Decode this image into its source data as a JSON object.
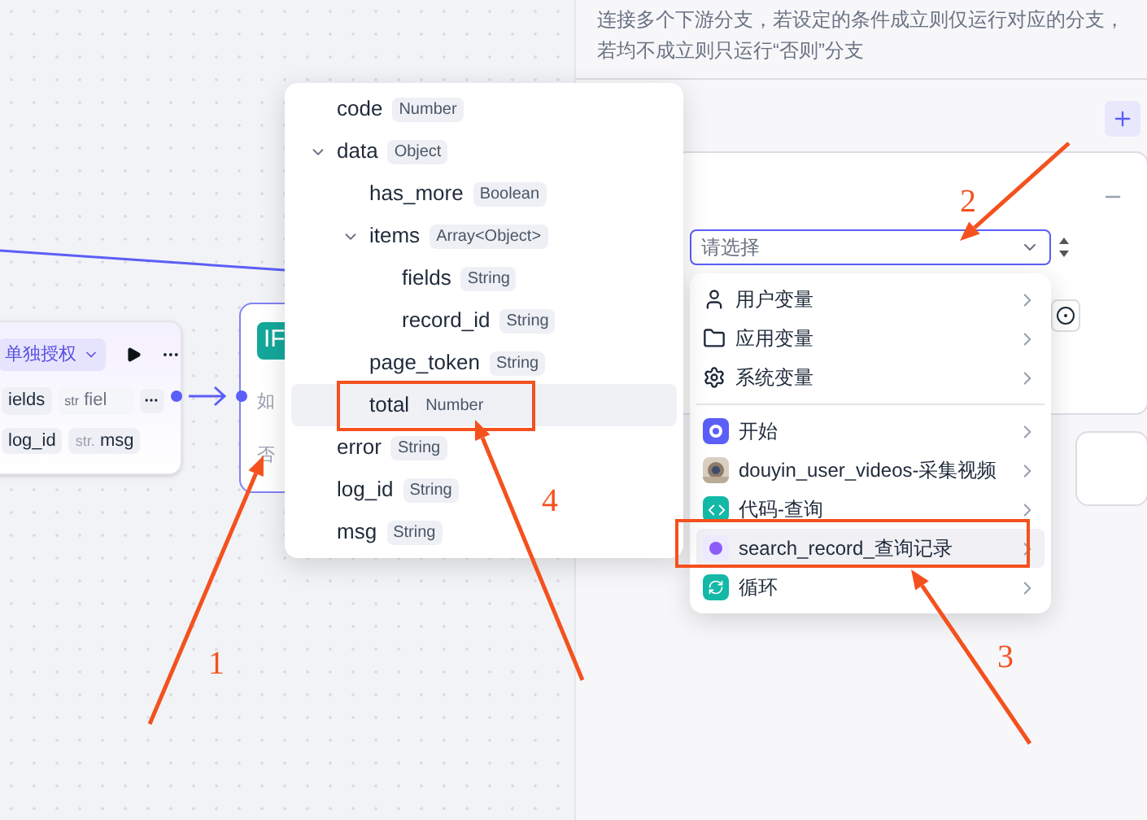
{
  "canvas": {
    "plugin_node": {
      "auth_tag": "单独授权",
      "input_name": "ields",
      "input_type": "str",
      "input_value": "fiel",
      "outputs": [
        {
          "name": "log_id"
        },
        {
          "type": "str.",
          "name": "msg"
        }
      ]
    },
    "if_node": {
      "badge": "IF",
      "branches": [
        "如",
        "否"
      ]
    }
  },
  "variable_tree": [
    {
      "name": "code",
      "type": "Number",
      "selected": false
    },
    {
      "name": "data",
      "type": "Object",
      "expanded": true,
      "selected": false,
      "children": [
        {
          "name": "has_more",
          "type": "Boolean",
          "selected": false
        },
        {
          "name": "items",
          "type": "Array<Object>",
          "expanded": true,
          "selected": false,
          "children": [
            {
              "name": "fields",
              "type": "String",
              "selected": false
            },
            {
              "name": "record_id",
              "type": "String",
              "selected": false
            }
          ]
        },
        {
          "name": "page_token",
          "type": "String",
          "selected": false
        },
        {
          "name": "total",
          "type": "Number",
          "selected": true
        }
      ]
    },
    {
      "name": "error",
      "type": "String",
      "selected": false
    },
    {
      "name": "log_id",
      "type": "String",
      "selected": false
    },
    {
      "name": "msg",
      "type": "String",
      "selected": false
    }
  ],
  "panel": {
    "description": "连接多个下游分支，若设定的条件成立则仅运行对应的分支，若均不成立则只运行“否则”分支",
    "select": {
      "placeholder": "请选择"
    },
    "menu": [
      {
        "kind": "user",
        "label": "用户变量",
        "selected": false
      },
      {
        "kind": "folder",
        "label": "应用变量",
        "selected": false
      },
      {
        "kind": "gear",
        "label": "系统变量",
        "selected": false
      },
      {
        "kind": "divider"
      },
      {
        "kind": "start",
        "label": "开始",
        "selected": false
      },
      {
        "kind": "thumbnail",
        "label": "douyin_user_videos-采集视频",
        "selected": false
      },
      {
        "kind": "code",
        "label": "代码-查询",
        "selected": false
      },
      {
        "kind": "plugin",
        "label": "search_record_查询记录",
        "selected": true
      },
      {
        "kind": "loop",
        "label": "循环",
        "selected": false
      }
    ]
  },
  "annotations": [
    {
      "label": "1"
    },
    {
      "label": "2"
    },
    {
      "label": "3"
    },
    {
      "label": "4"
    }
  ]
}
